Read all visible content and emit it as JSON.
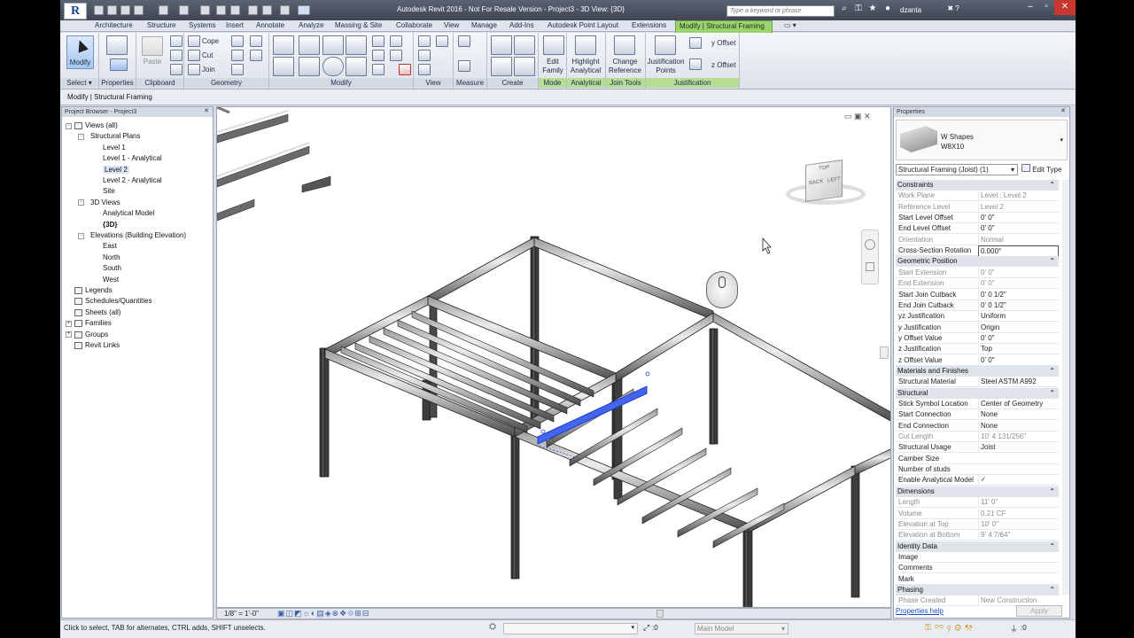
{
  "title_bar": {
    "app_title": "Autodesk Revit 2016 - Not For Resale Version -    Project3 - 3D View: {3D}",
    "search_placeholder": "Type a keyword or phrase",
    "user": "dzanta",
    "logo": "R"
  },
  "tabs": [
    "Architecture",
    "Structure",
    "Systems",
    "Insert",
    "Annotate",
    "Analyze",
    "Massing & Site",
    "Collaborate",
    "View",
    "Manage",
    "Add-Ins",
    "Autodesk Point Layout",
    "Extensions",
    "Modify | Structural Framing"
  ],
  "active_tab": "Modify | Structural Framing",
  "ribbon": {
    "modify": "Modify",
    "properties": "Properties",
    "clipboard_paste": "Paste",
    "cope": "Cope",
    "cut": "Cut",
    "join": "Join",
    "edit_family": [
      "Edit",
      "Family"
    ],
    "highlight_analytical": [
      "Highlight",
      "Analytical"
    ],
    "change_reference": [
      "Change",
      "Reference"
    ],
    "justification_points": [
      "Justification",
      "Points"
    ],
    "y_offset": "y Offset",
    "z_offset": "z Offset",
    "panels": [
      "Select",
      "Properties",
      "Clipboard",
      "Geometry",
      "Modify",
      "View",
      "Measure",
      "Create",
      "Mode",
      "Analytical",
      "Join Tools",
      "Justification"
    ]
  },
  "context_bar": "Modify | Structural Framing",
  "project_browser": {
    "title": "Project Browser - Project3",
    "items": [
      {
        "label": "Views (all)",
        "level": 0,
        "toggle": "-"
      },
      {
        "label": "Structural Plans",
        "level": 1,
        "toggle": "-"
      },
      {
        "label": "Level 1",
        "level": 2
      },
      {
        "label": "Level 1 - Analytical",
        "level": 2
      },
      {
        "label": "Level 2",
        "level": 2,
        "selected": true
      },
      {
        "label": "Level 2 - Analytical",
        "level": 2
      },
      {
        "label": "Site",
        "level": 2
      },
      {
        "label": "3D Views",
        "level": 1,
        "toggle": "-"
      },
      {
        "label": "Analytical Model",
        "level": 2
      },
      {
        "label": "{3D}",
        "level": 2,
        "bold": true
      },
      {
        "label": "Elevations (Building Elevation)",
        "level": 1,
        "toggle": "-"
      },
      {
        "label": "East",
        "level": 2
      },
      {
        "label": "North",
        "level": 2
      },
      {
        "label": "South",
        "level": 2
      },
      {
        "label": "West",
        "level": 2
      },
      {
        "label": "Legends",
        "level": 0
      },
      {
        "label": "Schedules/Quantities",
        "level": 0
      },
      {
        "label": "Sheets (all)",
        "level": 0
      },
      {
        "label": "Families",
        "level": 0,
        "toggle": "+"
      },
      {
        "label": "Groups",
        "level": 0,
        "toggle": "+"
      },
      {
        "label": "Revit Links",
        "level": 0
      }
    ]
  },
  "viewcube": {
    "back": "BACK",
    "left": "LEFT",
    "top": "TOP"
  },
  "view_control": {
    "scale": "1/8\" = 1'-0\""
  },
  "properties": {
    "title": "Properties",
    "family_name": "W Shapes",
    "type_name": "W8X10",
    "type_selector": "Structural Framing (Joist) (1)",
    "edit_type": "Edit Type",
    "help_link": "Properties help",
    "apply": "Apply",
    "rows": [
      {
        "section": "Constraints"
      },
      {
        "k": "Work Plane",
        "v": "Level : Level 2",
        "dim": true
      },
      {
        "k": "Reference Level",
        "v": "Level 2",
        "dim": true
      },
      {
        "k": "Start Level Offset",
        "v": "0'  0\""
      },
      {
        "k": "End Level Offset",
        "v": "0'  0\""
      },
      {
        "k": "Orientation",
        "v": "Normal",
        "dim": true
      },
      {
        "k": "Cross-Section Rotation",
        "v": "0.000°",
        "edit": true
      },
      {
        "section": "Geometric Position"
      },
      {
        "k": "Start Extension",
        "v": "0'  0\"",
        "dim": true
      },
      {
        "k": "End Extension",
        "v": "0'  0\"",
        "dim": true
      },
      {
        "k": "Start Join Cutback",
        "v": "0'  0 1/2\""
      },
      {
        "k": "End Join Cutback",
        "v": "0'  0 1/2\""
      },
      {
        "k": "yz Justification",
        "v": "Uniform"
      },
      {
        "k": "y Justification",
        "v": "Origin"
      },
      {
        "k": "y Offset Value",
        "v": "0'  0\""
      },
      {
        "k": "z Justification",
        "v": "Top"
      },
      {
        "k": "z Offset Value",
        "v": "0'  0\""
      },
      {
        "section": "Materials and Finishes"
      },
      {
        "k": "Structural Material",
        "v": "Steel ASTM A992"
      },
      {
        "section": "Structural"
      },
      {
        "k": "Stick Symbol Location",
        "v": "Center of Geometry"
      },
      {
        "k": "Start Connection",
        "v": "None"
      },
      {
        "k": "End Connection",
        "v": "None"
      },
      {
        "k": "Cut Length",
        "v": "10'  4 131/256\"",
        "dim": true
      },
      {
        "k": "Structural Usage",
        "v": "Joist"
      },
      {
        "k": "Camber Size",
        "v": ""
      },
      {
        "k": "Number of studs",
        "v": ""
      },
      {
        "k": "Enable Analytical Model",
        "v": "✓"
      },
      {
        "section": "Dimensions"
      },
      {
        "k": "Length",
        "v": "11'  0\"",
        "dim": true
      },
      {
        "k": "Volume",
        "v": "0.21 CF",
        "dim": true
      },
      {
        "k": "Elevation at Top",
        "v": "10'  0\"",
        "dim": true
      },
      {
        "k": "Elevation at Bottom",
        "v": "9'  4 7/64\"",
        "dim": true
      },
      {
        "section": "Identity Data"
      },
      {
        "k": "Image",
        "v": ""
      },
      {
        "k": "Comments",
        "v": ""
      },
      {
        "k": "Mark",
        "v": ""
      },
      {
        "section": "Phasing"
      },
      {
        "k": "Phase Created",
        "v": "New Construction",
        "dim": true
      }
    ]
  },
  "status_bar": {
    "message": "Click to select, TAB for alternates, CTRL adds, SHIFT unselects.",
    "coord": ":0",
    "model": "Main Model",
    "filter_count": ":0"
  }
}
